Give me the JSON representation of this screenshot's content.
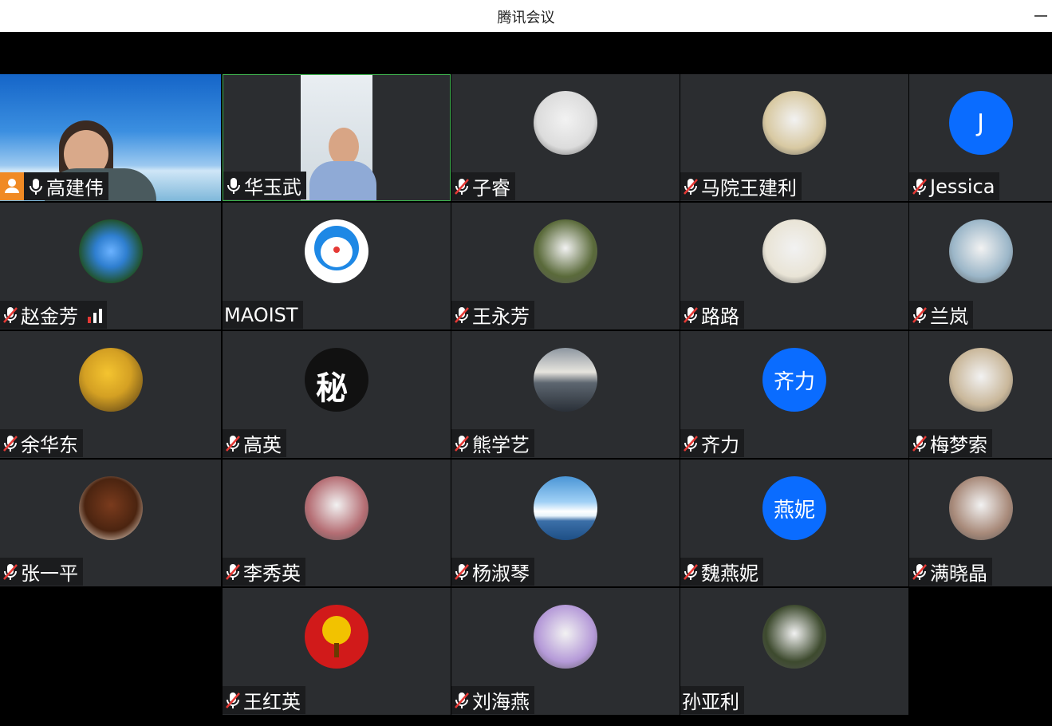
{
  "window": {
    "title": "腾讯会议"
  },
  "participants": [
    {
      "name": "高建伟",
      "mic": "on",
      "host": true,
      "video": "sky"
    },
    {
      "name": "华玉武",
      "mic": "on",
      "video": "room",
      "active": true
    },
    {
      "name": "子睿",
      "mic": "muted",
      "avatar": "portrait",
      "color": "#dcdcdc"
    },
    {
      "name": "马院王建利",
      "mic": "muted",
      "avatar": "calligraphy",
      "color": "#d8c9a2"
    },
    {
      "name": "Jessica",
      "mic": "muted",
      "avatar_letter": "J",
      "color": "#0a6cff"
    },
    {
      "name": "赵金芳",
      "mic": "muted",
      "signal": true,
      "avatar": "flowers-blue",
      "color": "#2f7fd0"
    },
    {
      "name": "MAOIST",
      "mic": "none",
      "avatar": "doraemon",
      "color": "#1e88e5"
    },
    {
      "name": "王永芳",
      "mic": "muted",
      "avatar": "flower-pink",
      "color": "#5a6a3a"
    },
    {
      "name": "路路",
      "mic": "muted",
      "avatar": "lotus-painting",
      "color": "#e9e4d6"
    },
    {
      "name": "兰岚",
      "mic": "muted",
      "avatar": "lake-photo",
      "color": "#9bb6c8"
    },
    {
      "name": "余华东",
      "mic": "muted",
      "avatar": "autumn-trees",
      "color": "#d4a023"
    },
    {
      "name": "高英",
      "mic": "muted",
      "avatar": "calligraphy-black",
      "color": "#111111"
    },
    {
      "name": "熊学艺",
      "mic": "muted",
      "avatar": "sea-sunset",
      "color": "#5d6670"
    },
    {
      "name": "齐力",
      "mic": "muted",
      "avatar_letter": "齐力",
      "color": "#0a6cff"
    },
    {
      "name": "梅梦索",
      "mic": "muted",
      "avatar": "children-photo",
      "color": "#c9b79a"
    },
    {
      "name": "张一平",
      "mic": "muted",
      "avatar": "teapot",
      "color": "#7a3b1d"
    },
    {
      "name": "李秀英",
      "mic": "muted",
      "avatar": "dancer",
      "color": "#b56e74"
    },
    {
      "name": "杨淑琴",
      "mic": "muted",
      "avatar": "clouds-lake",
      "color": "#4a95d6"
    },
    {
      "name": "魏燕妮",
      "mic": "muted",
      "avatar_letter": "燕妮",
      "color": "#0a6cff"
    },
    {
      "name": "满晓晶",
      "mic": "muted",
      "avatar": "peach-blossom",
      "color": "#a88a7a"
    },
    {
      "name": "王红英",
      "mic": "muted",
      "avatar": "gold-tree-red",
      "color": "#d11a1a"
    },
    {
      "name": "刘海燕",
      "mic": "muted",
      "avatar": "purple-flowers",
      "color": "#b59ad8"
    },
    {
      "name": "孙亚利",
      "mic": "none",
      "avatar": "orchid",
      "color": "#3d4a2e"
    }
  ],
  "colors": {
    "tile_bg": "#2b2d30",
    "namebar_bg": "#1b1c1e",
    "active_border": "#3fb24f",
    "muted_red": "#e53935",
    "host_orange": "#f08a24",
    "letter_avatar": "#0a6cff"
  }
}
